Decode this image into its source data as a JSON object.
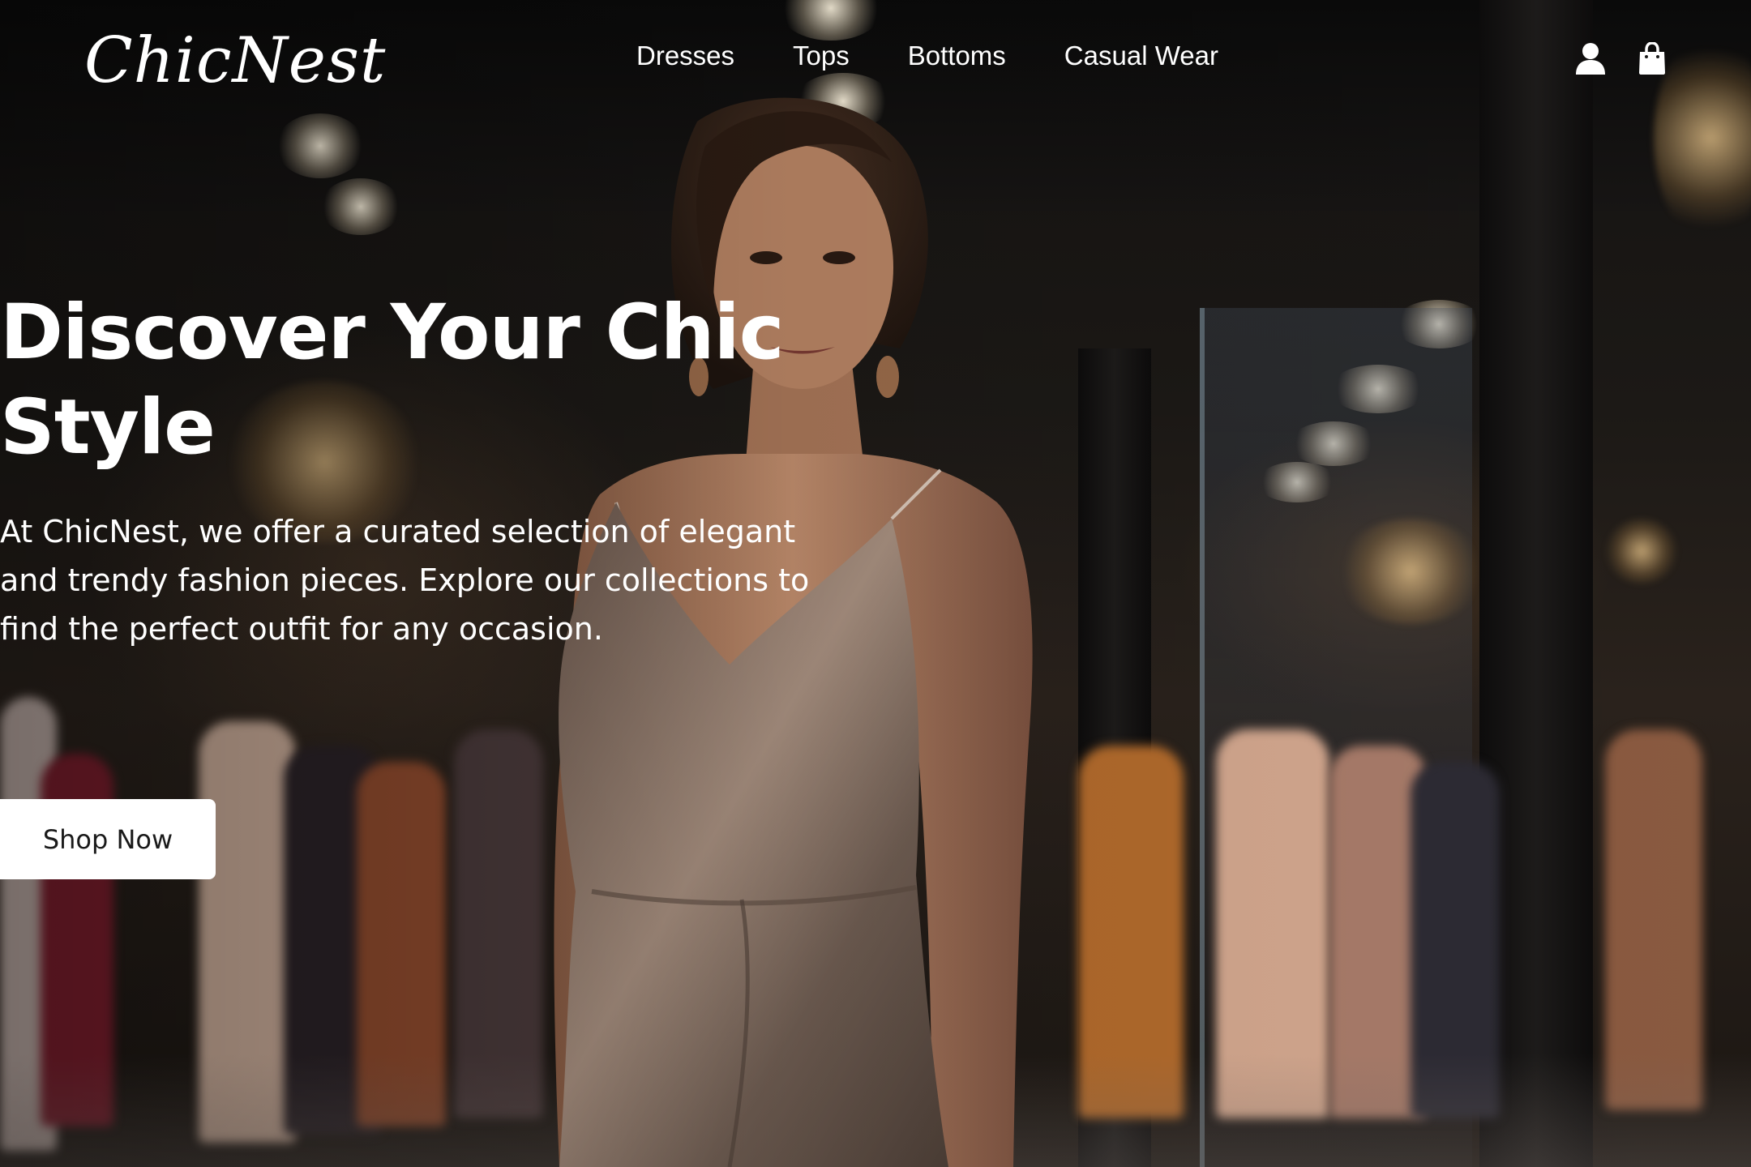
{
  "header": {
    "logo": "ChicNest",
    "nav": [
      "Dresses",
      "Tops",
      "Bottoms",
      "Casual Wear"
    ],
    "icons": [
      "user-icon",
      "shopping-bag-icon"
    ]
  },
  "hero": {
    "title": "Discover Your Chic Style",
    "description": "At ChicNest, we offer a curated selection of elegant and trendy fashion pieces. Explore our collections to find the perfect outfit for any occasion.",
    "button": "Shop Now"
  },
  "colors": {
    "text": "#ffffff",
    "button_bg": "#ffffff",
    "button_text": "#1a1a1a"
  }
}
